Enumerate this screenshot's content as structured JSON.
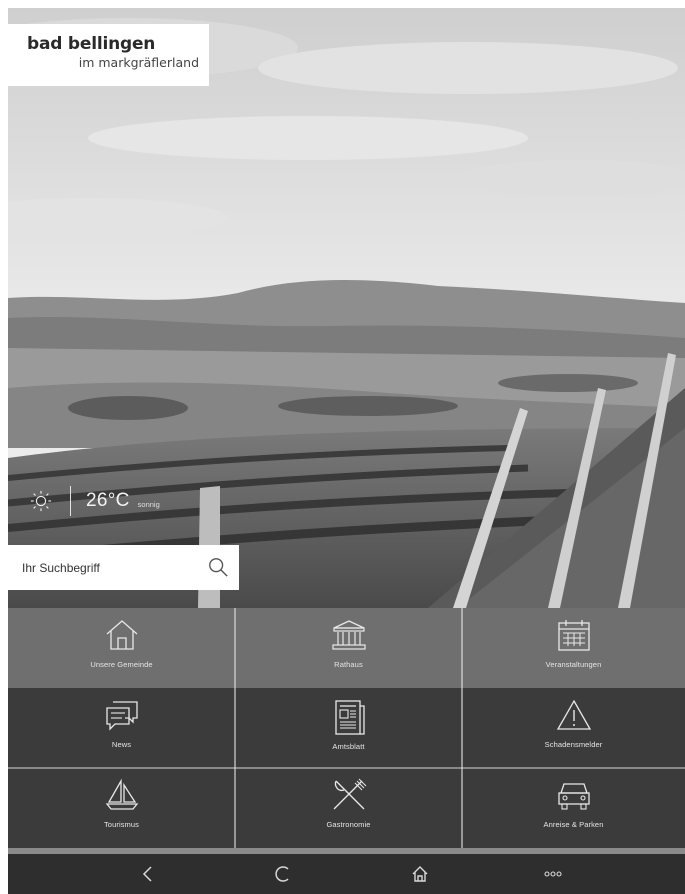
{
  "app": {
    "logo_title": "bad bellingen",
    "logo_subtitle": "im markgräflerland"
  },
  "weather": {
    "icon": "sun-icon",
    "temperature": "26°C",
    "condition": "sonnig"
  },
  "search": {
    "placeholder": "Ihr Suchbegriff",
    "icon": "search-icon"
  },
  "tiles": [
    {
      "label": "Unsere Gemeinde",
      "icon": "house-icon"
    },
    {
      "label": "Rathaus",
      "icon": "townhall-icon"
    },
    {
      "label": "Veranstaltungen",
      "icon": "calendar-icon"
    },
    {
      "label": "News",
      "icon": "chat-bubbles-icon"
    },
    {
      "label": "Amtsblatt",
      "icon": "newspaper-icon"
    },
    {
      "label": "Schadensmelder",
      "icon": "warning-icon"
    },
    {
      "label": "Tourismus",
      "icon": "sailboat-icon"
    },
    {
      "label": "Gastronomie",
      "icon": "fork-knife-icon"
    },
    {
      "label": "Anreise & Parken",
      "icon": "car-icon"
    }
  ],
  "navbar": {
    "back_icon": "back-chevron-icon",
    "reload_icon": "reload-icon",
    "home_icon": "home-icon",
    "more_icon": "more-dots-icon"
  },
  "colors": {
    "tile_light": "#6f6f6f",
    "tile_dark": "#3b3b3b",
    "navbar": "#2e2e2e",
    "logo_bg": "#ffffff"
  }
}
